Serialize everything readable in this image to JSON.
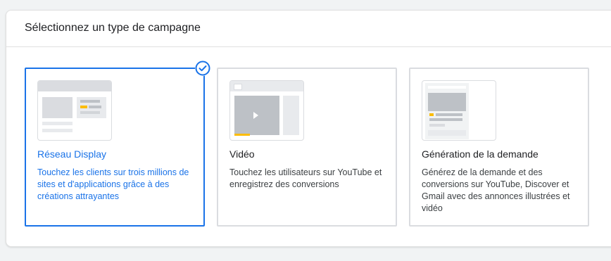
{
  "panel": {
    "title": "Sélectionnez un type de campagne"
  },
  "cards": [
    {
      "title": "Réseau Display",
      "description": "Touchez les clients sur trois millions de sites et d'applications grâce à des créations attrayantes",
      "selected": true
    },
    {
      "title": "Vidéo",
      "description": "Touchez les utilisateurs sur YouTube et enregistrez des conversions",
      "selected": false
    },
    {
      "title": "Génération de la demande",
      "description": "Générez de la demande et des conversions sur YouTube, Discover et Gmail avec des annonces illustrées et vidéo",
      "selected": false
    }
  ],
  "colors": {
    "accent": "#1a73e8",
    "highlight": "#fbbc04",
    "border": "#dadce0"
  },
  "icons": {
    "selected": "check-circle-icon",
    "play": "play-icon"
  }
}
